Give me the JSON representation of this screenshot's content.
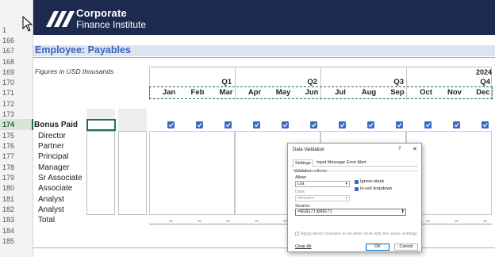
{
  "colors": {
    "banner": "#1b2a4e",
    "section_title": "#3a63b8",
    "checkbox": "#3a6bc4",
    "active_cell": "#217346"
  },
  "logo": {
    "line1": "Corporate",
    "line2": "Finance Institute",
    "icon": "cfi-logo-icon"
  },
  "row_numbers": [
    "1",
    "166",
    "167",
    "168",
    "169",
    "170",
    "171",
    "172",
    "173",
    "174",
    "175",
    "176",
    "177",
    "178",
    "179",
    "180",
    "181",
    "182",
    "183",
    "184",
    "185"
  ],
  "section_title": "Employee: Payables",
  "units_note": "Figures in USD thousands",
  "year": "2024",
  "quarters": [
    "Q1",
    "Q2",
    "Q3",
    "Q4"
  ],
  "months": [
    "Jan",
    "Feb",
    "Mar",
    "Apr",
    "May",
    "Jun",
    "Jul",
    "Aug",
    "Sep",
    "Oct",
    "Nov",
    "Dec"
  ],
  "rows": {
    "bonus_paid": "Bonus Paid",
    "roles": [
      "Director",
      "Partner",
      "Principal",
      "Manager",
      "Sr Associate",
      "Associate",
      "Analyst",
      "Analyst"
    ],
    "total": "Total"
  },
  "total_placeholder": "–",
  "dialog": {
    "title": "Data Validation",
    "help": "?",
    "close": "✕",
    "tabs": [
      "Settings",
      "Input Message",
      "Error Alert"
    ],
    "criteria_label": "Validation criteria",
    "allow_label": "Allow:",
    "allow_value": "List",
    "ignore_blank": "Ignore blank",
    "in_cell_dropdown": "In-cell dropdown",
    "data_label": "Data:",
    "data_value": "between",
    "source_label": "Source:",
    "source_value": "=$G$171:$R$171",
    "apply_all": "Apply these changes to all other cells with the same settings",
    "clear_all": "Clear All",
    "ok": "OK",
    "cancel": "Cancel"
  }
}
